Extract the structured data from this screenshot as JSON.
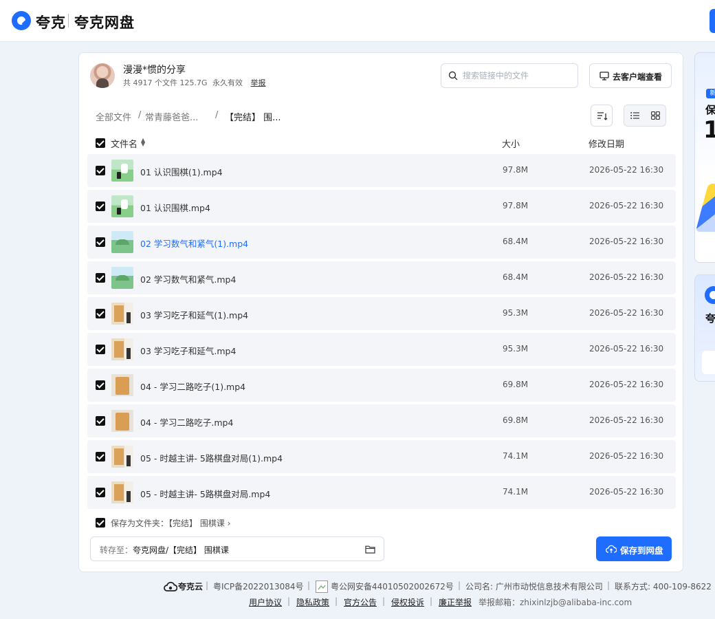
{
  "header": {
    "brand": "夸克",
    "product": "夸克网盘"
  },
  "share": {
    "title": "漫漫*惯的分享",
    "file_count": "共 4917 个文件 125.7G",
    "validity": "永久有效",
    "report": "举报",
    "search_placeholder": "搜索链接中的文件",
    "client_button": "去客户端查看"
  },
  "breadcrumb": [
    "全部文件",
    "/",
    "常青藤爸爸...",
    "/",
    "【完结】 围..."
  ],
  "columns": {
    "name": "文件名",
    "size": "大小",
    "date": "修改日期"
  },
  "files": [
    {
      "name": "01 认识围棋(1).mp4",
      "size": "97.8M",
      "date": "2026-05-22 16:30",
      "thumb": "go-class-cartoon",
      "highlight": false
    },
    {
      "name": "01 认识围棋.mp4",
      "size": "97.8M",
      "date": "2026-05-22 16:30",
      "thumb": "go-class-cartoon",
      "highlight": false
    },
    {
      "name": "02 学习数气和紧气(1).mp4",
      "size": "68.4M",
      "date": "2026-05-22 16:30",
      "thumb": "landscape-cartoon",
      "highlight": true
    },
    {
      "name": "02 学习数气和紧气.mp4",
      "size": "68.4M",
      "date": "2026-05-22 16:30",
      "thumb": "landscape-cartoon",
      "highlight": false
    },
    {
      "name": "03 学习吃子和延气(1).mp4",
      "size": "95.3M",
      "date": "2026-05-22 16:30",
      "thumb": "teacher-board",
      "highlight": false
    },
    {
      "name": "03 学习吃子和延气.mp4",
      "size": "95.3M",
      "date": "2026-05-22 16:30",
      "thumb": "teacher-board",
      "highlight": false
    },
    {
      "name": "04 - 学习二路吃子(1).mp4",
      "size": "69.8M",
      "date": "2026-05-22 16:30",
      "thumb": "board-box",
      "highlight": false
    },
    {
      "name": "04 - 学习二路吃子.mp4",
      "size": "69.8M",
      "date": "2026-05-22 16:30",
      "thumb": "board-box",
      "highlight": false
    },
    {
      "name": "05 - 时越主讲- 5路棋盘对局(1).mp4",
      "size": "74.1M",
      "date": "2026-05-22 16:30",
      "thumb": "teacher-board",
      "highlight": false
    },
    {
      "name": "05 - 时越主讲- 5路棋盘对局.mp4",
      "size": "74.1M",
      "date": "2026-05-22 16:30",
      "thumb": "teacher-board",
      "highlight": false
    }
  ],
  "save": {
    "save_as": "保存为文件夹：【完结】 围棋课 ›",
    "dest_prefix": "转存至：",
    "dest_path": "夸克网盘/【完结】 围棋课",
    "save_button": "保存到网盘"
  },
  "ads": {
    "ad1_tag": "新",
    "ad1_line1": "保",
    "ad1_line2": "1",
    "ad2_text": "夸"
  },
  "footer": {
    "logo": "夸克云",
    "icp": "粤ICP备2022013084号",
    "police": "粤公网安备44010502002672号",
    "company": "公司名: 广州市动悦信息技术有限公司",
    "contact": "联系方式: 400-109-8622",
    "links": [
      "用户协议",
      "隐私政策",
      "官方公告",
      "侵权投诉",
      "廉正举报"
    ],
    "report_email": "举报邮箱：zhixinlzjb@alibaba-inc.com"
  },
  "colors": {
    "accent": "#1f6dff",
    "background": "#eef2f9",
    "row_background": "#f4f5f8"
  }
}
